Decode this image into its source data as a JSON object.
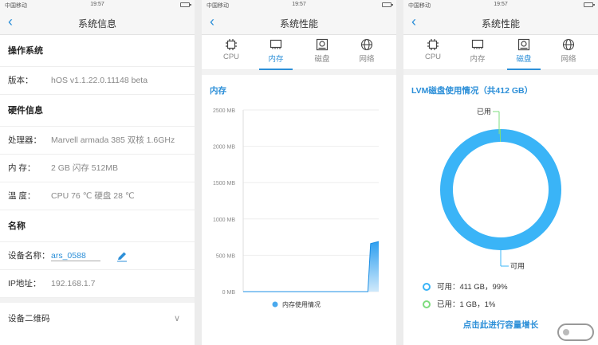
{
  "status": {
    "carrier": "中国移动",
    "time": "19:57"
  },
  "panel1": {
    "title": "系统信息",
    "os_section": "操作系统",
    "version_label": "版本：",
    "version_value": "hOS v1.1.22.0.11148 beta",
    "hw_section": "硬件信息",
    "cpu_label": "处理器：",
    "cpu_value": "Marvell armada 385 双核 1.6GHz",
    "mem_label": "内  存：",
    "mem_value": "2 GB 闪存 512MB",
    "temp_label": "温  度：",
    "temp_value": "CPU 76 ℃ 硬盘 28 ℃",
    "name_section": "名称",
    "device_name_label": "设备名称：",
    "device_name_value": "ars_0588",
    "ip_label": "IP地址：",
    "ip_value": "192.168.1.7",
    "qr_label": "设备二维码"
  },
  "perf": {
    "title": "系统性能",
    "tabs": [
      {
        "label": "CPU",
        "icon": "cpu-icon"
      },
      {
        "label": "内存",
        "icon": "memory-icon"
      },
      {
        "label": "磁盘",
        "icon": "disk-icon"
      },
      {
        "label": "网络",
        "icon": "globe-icon"
      }
    ]
  },
  "panel2": {
    "active_tab": 1,
    "section_title": "内存"
  },
  "panel3": {
    "active_tab": 2,
    "section_title": "LVM磁盘使用情况（共412 GB）",
    "used_label": "已用",
    "free_label": "可用",
    "legend_free": "可用：411 GB，99%",
    "legend_used": "已用：1 GB，1%",
    "link": "点击此进行容量增长",
    "colors": {
      "free": "#3ab4f7",
      "used": "#7ddc7d"
    }
  },
  "chart_data": [
    {
      "type": "area",
      "title": "内存",
      "legend": [
        "内存使用情况"
      ],
      "y_ticks": [
        "2500 MB",
        "2000 MB",
        "1500 MB",
        "1000 MB",
        "500 MB",
        "0 MB"
      ],
      "ylim": [
        0,
        2500
      ],
      "series": [
        {
          "name": "内存使用情况",
          "values": [
            0,
            0,
            0,
            0,
            0,
            0,
            0,
            0,
            0,
            0,
            0,
            0,
            0,
            0,
            0,
            0,
            0,
            0,
            0,
            0,
            0,
            0,
            0,
            0,
            0,
            0,
            0,
            0,
            0,
            0,
            0,
            0,
            0,
            0,
            0,
            0,
            0,
            0,
            0,
            0,
            0,
            0,
            0,
            0,
            0,
            0,
            0,
            660,
            670,
            680,
            690
          ]
        }
      ]
    },
    {
      "type": "pie",
      "title": "LVM磁盘使用情况（共412 GB）",
      "categories": [
        "可用",
        "已用"
      ],
      "values": [
        411,
        1
      ],
      "units": "GB",
      "percent": [
        99,
        1
      ]
    }
  ]
}
